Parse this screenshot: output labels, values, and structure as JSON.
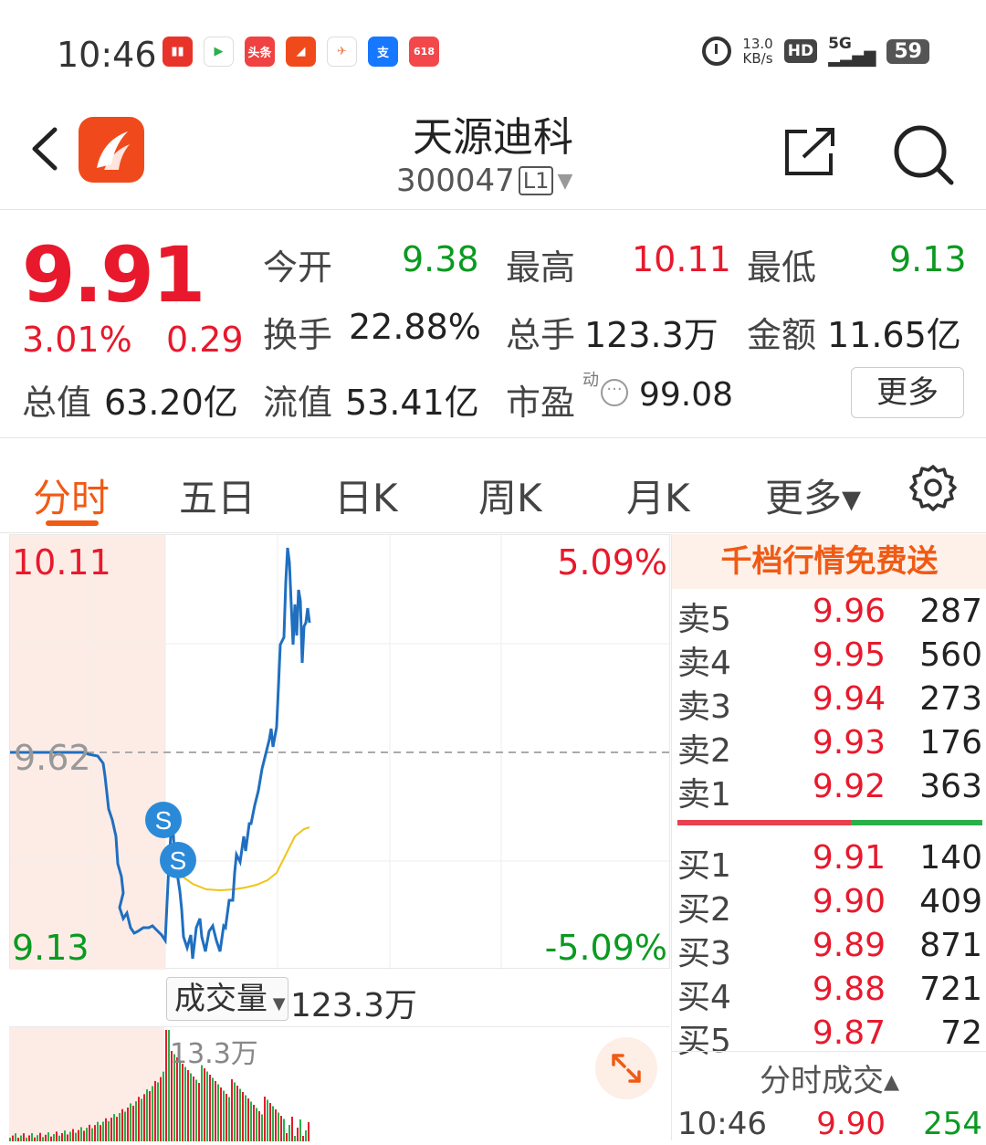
{
  "status_bar": {
    "time": "10:46",
    "net_speed_value": "13.0",
    "net_speed_unit": "KB/s",
    "hd": "HD",
    "network": "5G",
    "battery": "59",
    "apps": [
      {
        "name": "app1",
        "color": "#e8332a",
        "glyph": "▮▮"
      },
      {
        "name": "app2",
        "color": "#ffffff",
        "glyph": "▶"
      },
      {
        "name": "toutiao",
        "color": "#f04242",
        "glyph": "头条"
      },
      {
        "name": "app4",
        "color": "#f04a1c",
        "glyph": "◢"
      },
      {
        "name": "app5",
        "color": "#ffffff",
        "glyph": "✈"
      },
      {
        "name": "alipay",
        "color": "#1677ff",
        "glyph": "支"
      },
      {
        "name": "app7",
        "color": "#f2484b",
        "glyph": "618"
      }
    ]
  },
  "header": {
    "title": "天源迪科",
    "code": "300047",
    "level": "L1"
  },
  "quote": {
    "price": "9.91",
    "pct": "3.01%",
    "change": "0.29",
    "open_label": "今开",
    "open": "9.38",
    "high_label": "最高",
    "high": "10.11",
    "low_label": "最低",
    "low": "9.13",
    "turnover_label": "换手",
    "turnover": "22.88%",
    "volume_label": "总手",
    "volume": "123.3万",
    "amount_label": "金额",
    "amount": "11.65亿",
    "mcap_label": "总值",
    "mcap": "63.20亿",
    "float_label": "流值",
    "float": "53.41亿",
    "pe_label": "市盈",
    "pe_sup": "动",
    "pe": "99.08",
    "more": "更多"
  },
  "tabs": [
    {
      "label": "分时",
      "active": true
    },
    {
      "label": "五日"
    },
    {
      "label": "日K"
    },
    {
      "label": "周K"
    },
    {
      "label": "月K"
    },
    {
      "label": "更多▾"
    }
  ],
  "chart": {
    "high_label": "10.11",
    "low_label": "9.13",
    "prev_close_label": "9.62",
    "pct_up": "5.09%",
    "pct_down": "-5.09%",
    "volume_selector": "成交量",
    "volume_total": "123.3万",
    "volume_max": "13.3万",
    "markers": [
      "S",
      "S"
    ]
  },
  "book": {
    "banner": "千档行情免费送",
    "asks": [
      {
        "label": "卖5",
        "price": "9.96",
        "vol": "287"
      },
      {
        "label": "卖4",
        "price": "9.95",
        "vol": "560"
      },
      {
        "label": "卖3",
        "price": "9.94",
        "vol": "273"
      },
      {
        "label": "卖2",
        "price": "9.93",
        "vol": "176"
      },
      {
        "label": "卖1",
        "price": "9.92",
        "vol": "363"
      }
    ],
    "bids": [
      {
        "label": "买1",
        "price": "9.91",
        "vol": "140"
      },
      {
        "label": "买2",
        "price": "9.90",
        "vol": "409"
      },
      {
        "label": "买3",
        "price": "9.89",
        "vol": "871"
      },
      {
        "label": "买4",
        "price": "9.88",
        "vol": "721"
      },
      {
        "label": "买5",
        "price": "9.87",
        "vol": "72"
      }
    ],
    "ticks_header": "分时成交▴",
    "tick": {
      "time": "10:46",
      "price": "9.90",
      "vol": "254"
    }
  },
  "colors": {
    "up": "#e8192c",
    "down": "#0a9a20",
    "accent": "#f05a14",
    "price_line": "#1f6fc0",
    "avg_line": "#f0c419"
  }
}
